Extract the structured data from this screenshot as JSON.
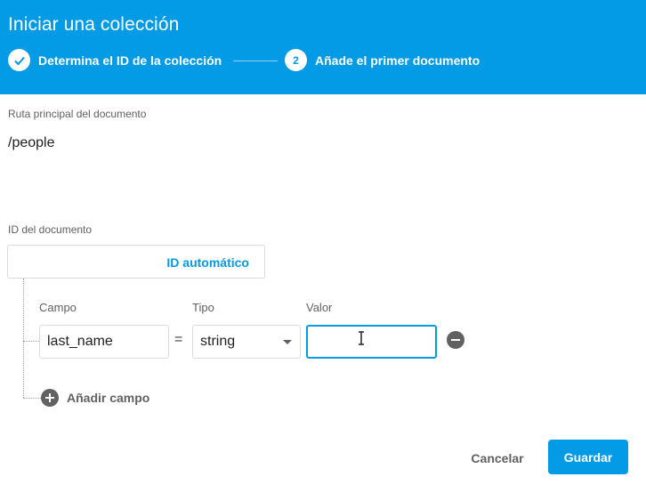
{
  "dialog": {
    "title": "Iniciar una colección",
    "steps": [
      {
        "number": "",
        "label": "Determina el ID de la colección",
        "status": "done"
      },
      {
        "number": "2",
        "label": "Añade el primer documento",
        "status": "active"
      }
    ]
  },
  "document_path": {
    "label": "Ruta principal del documento",
    "value": "/people"
  },
  "document_id": {
    "label": "ID del documento",
    "value": "",
    "auto_id_label": "ID automático"
  },
  "fields": {
    "headers": {
      "field": "Campo",
      "type": "Tipo",
      "value": "Valor"
    },
    "rows": [
      {
        "field": "last_name",
        "operator": "=",
        "type": "string",
        "value": ""
      }
    ],
    "add_field_label": "Añadir campo"
  },
  "actions": {
    "cancel": "Cancelar",
    "save": "Guardar"
  },
  "colors": {
    "accent": "#039be5",
    "icon_gray": "#616161"
  }
}
